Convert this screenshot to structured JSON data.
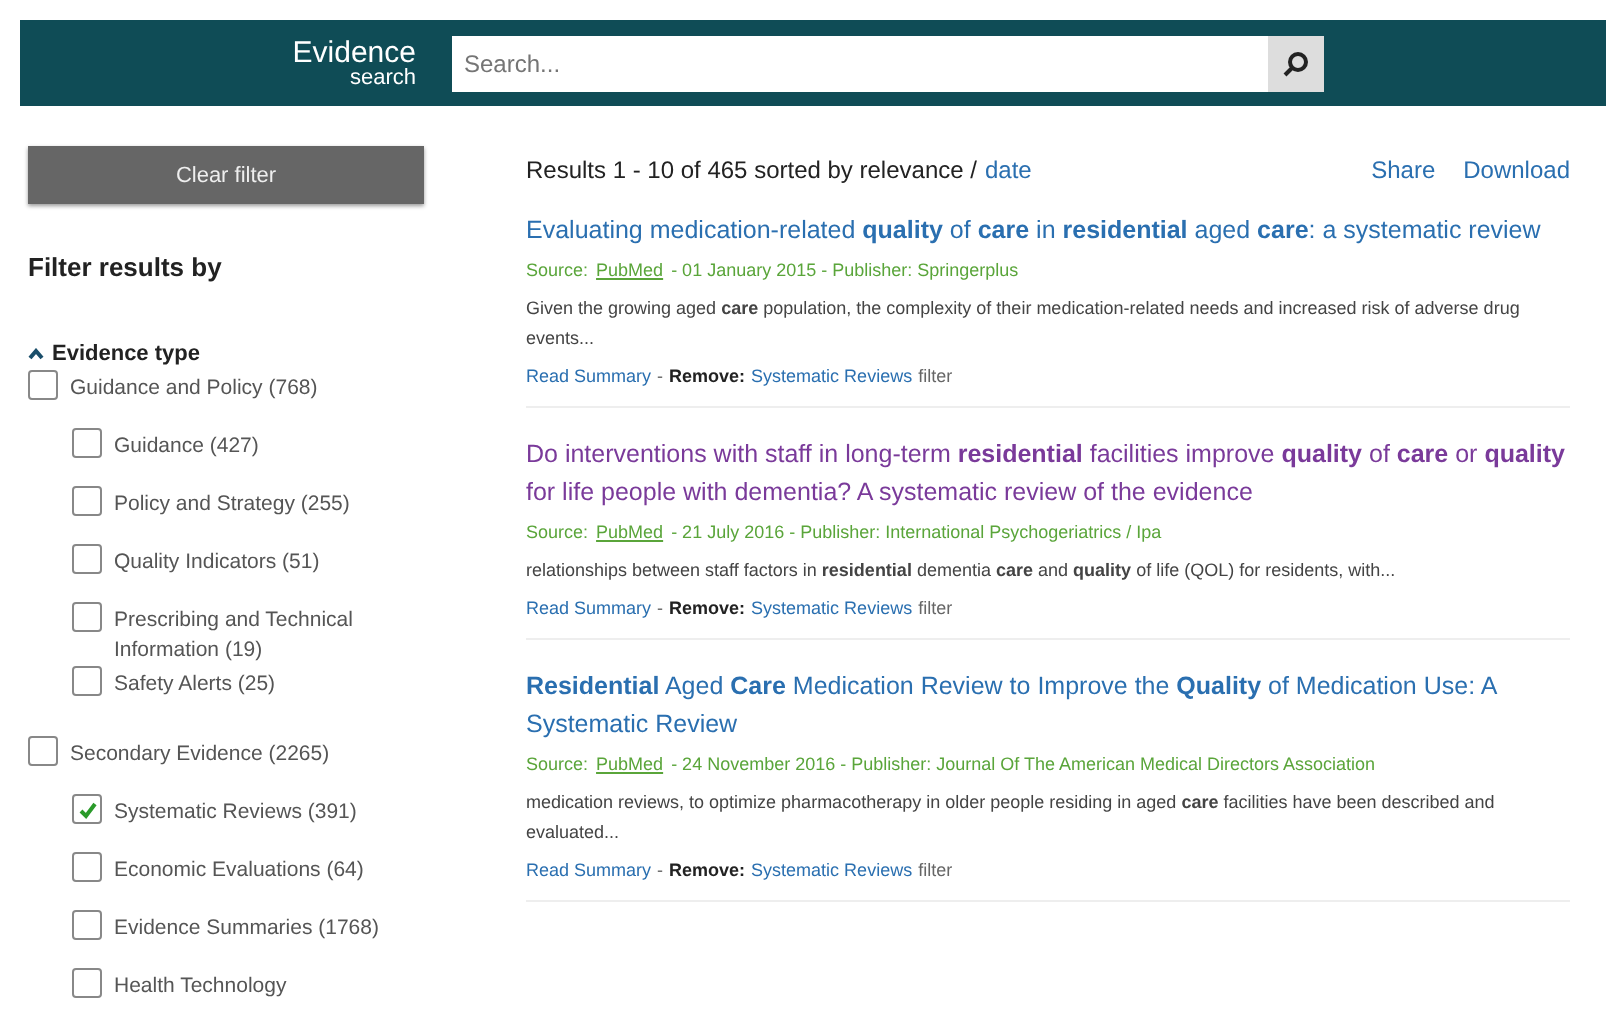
{
  "header": {
    "logo_main": "Evidence",
    "logo_sub": "search",
    "search": {
      "placeholder": "Search..."
    }
  },
  "sidebar": {
    "clear_button": "Clear filter",
    "heading": "Filter results by",
    "group": {
      "label": "Evidence type",
      "expanded": true,
      "items": [
        {
          "label": "Guidance and Policy (768)",
          "checked": false,
          "children": [
            {
              "label": "Guidance (427)",
              "checked": false
            },
            {
              "label": "Policy and Strategy (255)",
              "checked": false
            },
            {
              "label": "Quality Indicators (51)",
              "checked": false
            },
            {
              "label": "Prescribing and Technical Information (19)",
              "checked": false
            },
            {
              "label": "Safety Alerts (25)",
              "checked": false
            }
          ]
        },
        {
          "label": "Secondary Evidence (2265)",
          "checked": false,
          "children": [
            {
              "label": "Systematic Reviews (391)",
              "checked": true
            },
            {
              "label": "Economic Evaluations (64)",
              "checked": false
            },
            {
              "label": "Evidence Summaries (1768)",
              "checked": false
            },
            {
              "label": "Health Technology",
              "checked": false
            }
          ]
        }
      ]
    }
  },
  "results_bar": {
    "summary": "Results 1 - 10 of 465 sorted by relevance /",
    "sort_link": "date",
    "actions": [
      "Share",
      "Download"
    ]
  },
  "results": [
    {
      "title": "Evaluating medication-related **quality** of **care** in **residential** aged **care**: a systematic review",
      "visited": false,
      "source_label": "Source:",
      "source": "PubMed",
      "meta": "- 01 January 2015 - Publisher: Springerplus",
      "snippet": "Given the growing aged **care** population, the complexity of their medication-related needs and increased risk of adverse drug events...",
      "read_link": "Read Summary",
      "separator": "-",
      "remove_label": "Remove:",
      "filter_link": "Systematic Reviews",
      "filter_word": "filter"
    },
    {
      "title": "Do interventions with staff in long-term **residential** facilities improve **quality** of **care** or **quality** for life people with dementia? A systematic review of the evidence",
      "visited": true,
      "source_label": "Source:",
      "source": "PubMed",
      "meta": "- 21 July 2016 - Publisher: International Psychogeriatrics / Ipa",
      "snippet": "relationships between staff factors in **residential** dementia **care** and **quality** of life (QOL) for residents, with...",
      "read_link": "Read Summary",
      "separator": "-",
      "remove_label": "Remove:",
      "filter_link": "Systematic Reviews",
      "filter_word": "filter"
    },
    {
      "title": "**Residential** Aged **Care** Medication Review to Improve the **Quality** of Medication Use: A Systematic Review",
      "visited": false,
      "source_label": "Source:",
      "source": "PubMed",
      "meta": "- 24 November 2016 - Publisher: Journal Of The American Medical Directors Association",
      "snippet": "medication reviews, to optimize pharmacotherapy in older people residing in aged **care** facilities have been described and evaluated...",
      "read_link": "Read Summary",
      "separator": "-",
      "remove_label": "Remove:",
      "filter_link": "Systematic Reviews",
      "filter_word": "filter"
    }
  ]
}
